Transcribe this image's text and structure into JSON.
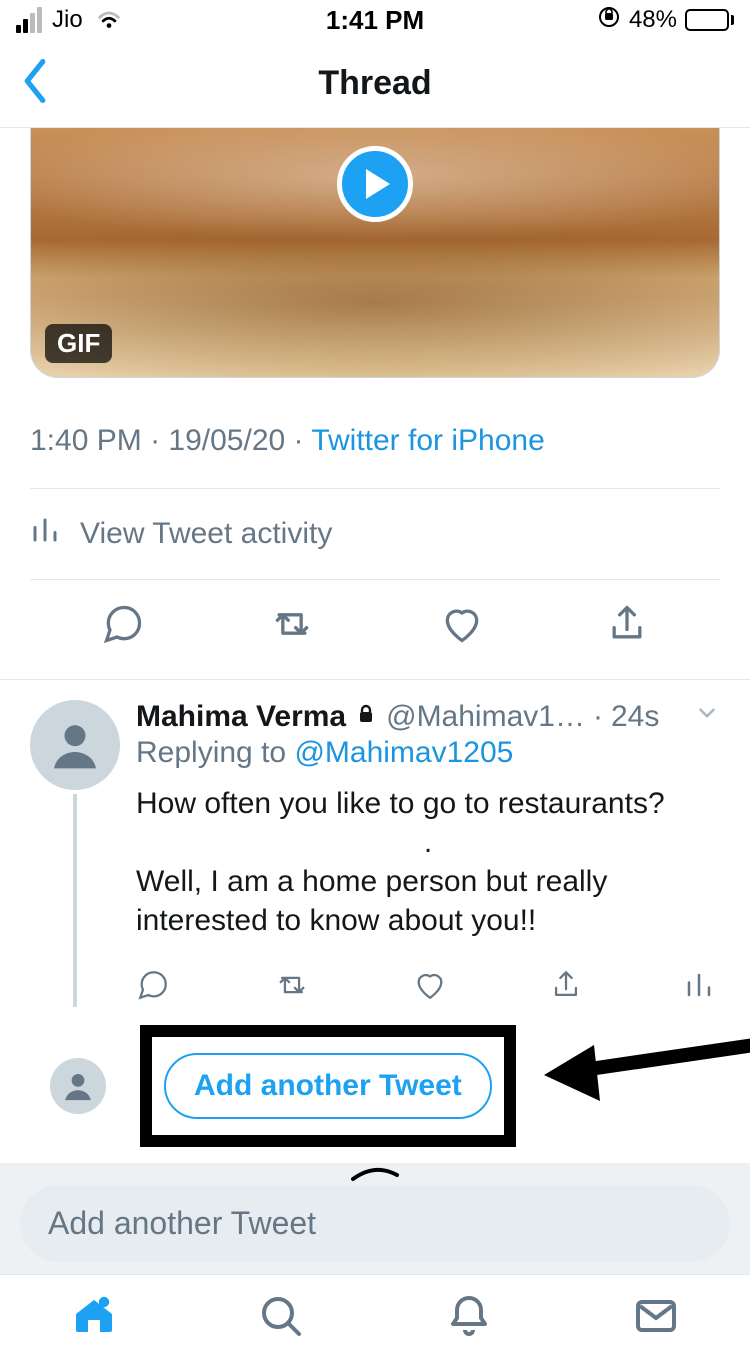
{
  "status": {
    "carrier": "Jio",
    "time": "1:41 PM",
    "battery_pct": "48%"
  },
  "nav": {
    "title": "Thread"
  },
  "media": {
    "badge": "GIF"
  },
  "tweet_meta": {
    "time": "1:40 PM",
    "date": "19/05/20",
    "source": "Twitter for iPhone"
  },
  "activity": {
    "label": "View Tweet activity"
  },
  "reply": {
    "name": "Mahima Verma",
    "handle": "@Mahimav1…",
    "time": "24s",
    "replying_prefix": "Replying to ",
    "replying_to": "@Mahimav1205",
    "line1": "How often you like to go to restaurants?",
    "line2": "Well, I am a home person but really interested to know about you!!"
  },
  "add_tweet": {
    "button": "Add another Tweet"
  },
  "composer": {
    "placeholder": "Add another Tweet"
  }
}
